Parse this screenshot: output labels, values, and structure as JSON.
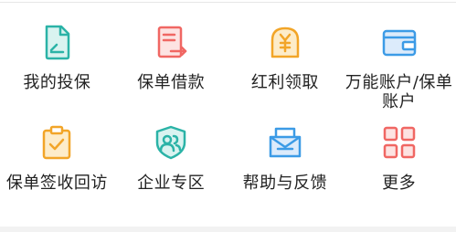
{
  "menu": {
    "items": [
      {
        "label": "我的投保",
        "icon": "document-sign-icon",
        "color": "#2bb3a7"
      },
      {
        "label": "保单借款",
        "icon": "policy-loan-icon",
        "color": "#f06763"
      },
      {
        "label": "红利领取",
        "icon": "yen-coin-icon",
        "color": "#f2a528"
      },
      {
        "label": "万能账户/保单账户",
        "icon": "wallet-card-icon",
        "color": "#3c9be6"
      },
      {
        "label": "保单签收回访",
        "icon": "clipboard-check-icon",
        "color": "#f2a528"
      },
      {
        "label": "企业专区",
        "icon": "enterprise-users-icon",
        "color": "#2bb3a7"
      },
      {
        "label": "帮助与反馈",
        "icon": "help-feedback-icon",
        "color": "#3c9be6"
      },
      {
        "label": "更多",
        "icon": "more-grid-icon",
        "color": "#f06763"
      }
    ]
  }
}
